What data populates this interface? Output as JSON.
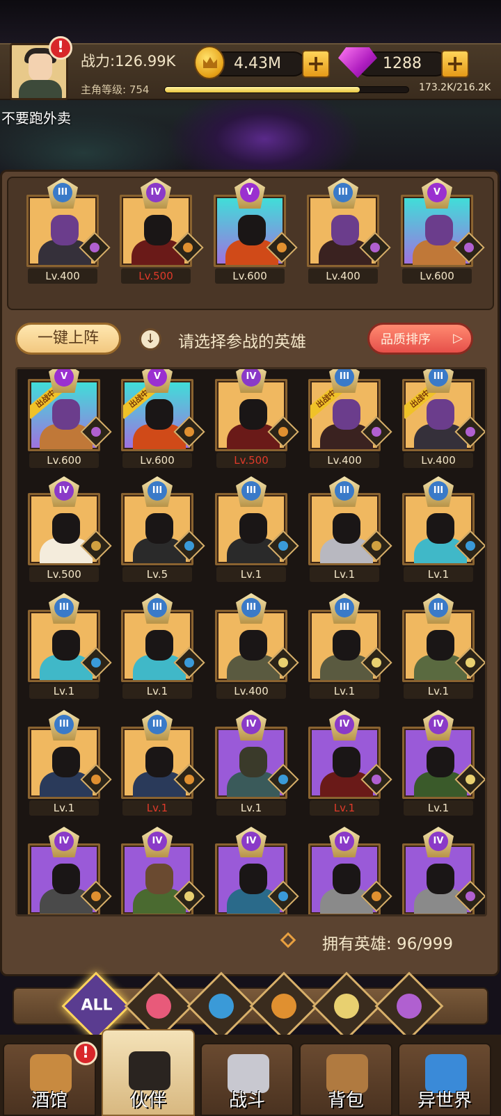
{
  "header": {
    "power": "战力:126.99K",
    "gold": "4.43M",
    "gems": "1288",
    "level_label": "主角等级: 754",
    "xp_text": "173.2K/216.2K",
    "xp_progress": 0.8,
    "username": "不要跑外卖",
    "alert": "!"
  },
  "team": [
    {
      "rank": "III",
      "level": "Lv.400",
      "max": false,
      "bg": "#f0b860",
      "hero": "#6b3d8c",
      "body": "#35303a",
      "faction": "#b060d0"
    },
    {
      "rank": "IV",
      "level": "Lv.500",
      "max": true,
      "bg": "#f0b860",
      "hero": "#1a1616",
      "body": "#6a1a18",
      "faction": "#e09030"
    },
    {
      "rank": "V",
      "level": "Lv.600",
      "max": false,
      "bg": "linear-gradient(#3ee0d8,#a070e0)",
      "hero": "#1a1616",
      "body": "#d04a18",
      "faction": "#e09030"
    },
    {
      "rank": "III",
      "level": "Lv.400",
      "max": false,
      "bg": "#f0b860",
      "hero": "#6b3d8c",
      "body": "#3a2220",
      "faction": "#b060d0"
    },
    {
      "rank": "V",
      "level": "Lv.600",
      "max": false,
      "bg": "linear-gradient(#3ee0d8,#a070e0)",
      "hero": "#6b3d8c",
      "body": "#c07838",
      "faction": "#b060d0"
    }
  ],
  "controls": {
    "one_key_label": "一键上阵",
    "info_icon": "↓",
    "select_hint": "请选择参战的英雄",
    "sort_label": "品质排序",
    "sort_arrow": "▷"
  },
  "deployed_tag": "出战中",
  "roster": [
    {
      "rank": "V",
      "level": "Lv.600",
      "max": false,
      "deployed": true,
      "bg": "linear-gradient(#3ee0d8,#a070e0)",
      "hero": "#6b3d8c",
      "body": "#c07838",
      "faction": "#b060d0"
    },
    {
      "rank": "V",
      "level": "Lv.600",
      "max": false,
      "deployed": true,
      "bg": "linear-gradient(#3ee0d8,#a070e0)",
      "hero": "#1a1616",
      "body": "#d04a18",
      "faction": "#e09030"
    },
    {
      "rank": "IV",
      "level": "Lv.500",
      "max": true,
      "deployed": false,
      "bg": "#f0b860",
      "hero": "#1a1616",
      "body": "#6a1a18",
      "faction": "#e09030"
    },
    {
      "rank": "III",
      "level": "Lv.400",
      "max": false,
      "deployed": true,
      "bg": "#f0b860",
      "hero": "#6b3d8c",
      "body": "#3a2220",
      "faction": "#b060d0"
    },
    {
      "rank": "III",
      "level": "Lv.400",
      "max": false,
      "deployed": true,
      "bg": "#f0b860",
      "hero": "#6b3d8c",
      "body": "#35303a",
      "faction": "#b060d0"
    },
    {
      "rank": "IV",
      "level": "Lv.500",
      "max": false,
      "deployed": false,
      "bg": "#f0b860",
      "hero": "#1a1616",
      "body": "#f4ecdc",
      "faction": "#d0a040"
    },
    {
      "rank": "III",
      "level": "Lv.5",
      "max": false,
      "deployed": false,
      "bg": "#f0b860",
      "hero": "#1a1616",
      "body": "#2a2a2a",
      "faction": "#3a9ad8"
    },
    {
      "rank": "III",
      "level": "Lv.1",
      "max": false,
      "deployed": false,
      "bg": "#f0b860",
      "hero": "#1a1616",
      "body": "#2a2a2a",
      "faction": "#3a9ad8"
    },
    {
      "rank": "III",
      "level": "Lv.1",
      "max": false,
      "deployed": false,
      "bg": "#f0b860",
      "hero": "#1a1616",
      "body": "#b8b8c0",
      "faction": "#d0a040"
    },
    {
      "rank": "III",
      "level": "Lv.1",
      "max": false,
      "deployed": false,
      "bg": "#f0b860",
      "hero": "#1a1616",
      "body": "#40b8c8",
      "faction": "#3a9ad8"
    },
    {
      "rank": "III",
      "level": "Lv.1",
      "max": false,
      "deployed": false,
      "bg": "#f0b860",
      "hero": "#1a1616",
      "body": "#40b8c8",
      "faction": "#3a9ad8"
    },
    {
      "rank": "III",
      "level": "Lv.1",
      "max": false,
      "deployed": false,
      "bg": "#f0b860",
      "hero": "#1a1616",
      "body": "#40b8c8",
      "faction": "#3a9ad8"
    },
    {
      "rank": "III",
      "level": "Lv.400",
      "max": false,
      "deployed": false,
      "bg": "#f0b860",
      "hero": "#1a1616",
      "body": "#5a5a40",
      "faction": "#e8d070"
    },
    {
      "rank": "III",
      "level": "Lv.1",
      "max": false,
      "deployed": false,
      "bg": "#f0b860",
      "hero": "#1a1616",
      "body": "#5a5a40",
      "faction": "#e8d070"
    },
    {
      "rank": "III",
      "level": "Lv.1",
      "max": false,
      "deployed": false,
      "bg": "#f0b860",
      "hero": "#1a1616",
      "body": "#5a6a40",
      "faction": "#e8d070"
    },
    {
      "rank": "III",
      "level": "Lv.1",
      "max": false,
      "deployed": false,
      "bg": "#f0b860",
      "hero": "#1a1616",
      "body": "#2a3a5a",
      "faction": "#e09030"
    },
    {
      "rank": "III",
      "level": "Lv.1",
      "max": true,
      "deployed": false,
      "bg": "#f0b860",
      "hero": "#1a1616",
      "body": "#2a3a5a",
      "faction": "#e09030"
    },
    {
      "rank": "IV",
      "level": "Lv.1",
      "max": false,
      "deployed": false,
      "bg": "#9a5ad8",
      "hero": "#3a3a2a",
      "body": "#3a5a5a",
      "faction": "#3a9ad8"
    },
    {
      "rank": "IV",
      "level": "Lv.1",
      "max": true,
      "deployed": false,
      "bg": "#9a5ad8",
      "hero": "#1a1616",
      "body": "#6a1a18",
      "faction": "#b060d0"
    },
    {
      "rank": "IV",
      "level": "Lv.1",
      "max": false,
      "deployed": false,
      "bg": "#9a5ad8",
      "hero": "#1a1616",
      "body": "#3a5a2a",
      "faction": "#e8d070"
    },
    {
      "rank": "IV",
      "level": "",
      "max": false,
      "deployed": false,
      "bg": "#9a5ad8",
      "hero": "#1a1616",
      "body": "#4a4a4a",
      "faction": "#e09030"
    },
    {
      "rank": "IV",
      "level": "",
      "max": false,
      "deployed": false,
      "bg": "#9a5ad8",
      "hero": "#6a4a30",
      "body": "#4a6a30",
      "faction": "#e8d070"
    },
    {
      "rank": "IV",
      "level": "",
      "max": false,
      "deployed": false,
      "bg": "#9a5ad8",
      "hero": "#1a1616",
      "body": "#2a6a8a",
      "faction": "#3a9ad8"
    },
    {
      "rank": "IV",
      "level": "",
      "max": false,
      "deployed": false,
      "bg": "#9a5ad8",
      "hero": "#1a1616",
      "body": "#8a8a8a",
      "faction": "#e09030"
    },
    {
      "rank": "IV",
      "level": "",
      "max": false,
      "deployed": false,
      "bg": "#9a5ad8",
      "hero": "#1a1616",
      "body": "#8a8a8a",
      "faction": "#b060d0"
    }
  ],
  "owned": "拥有英雄: 96/999",
  "filters": [
    {
      "name": "filter-all",
      "label": "ALL",
      "color": "#5a3c90"
    },
    {
      "name": "filter-knight-icon",
      "label": "",
      "color": "#e85a7a"
    },
    {
      "name": "filter-fish-icon",
      "label": "",
      "color": "#3a9ad8"
    },
    {
      "name": "filter-lion-icon",
      "label": "",
      "color": "#e09030"
    },
    {
      "name": "filter-elf-icon",
      "label": "",
      "color": "#e8d070"
    },
    {
      "name": "filter-demon-icon",
      "label": "",
      "color": "#b060d0"
    }
  ],
  "nav": [
    {
      "label": "酒馆",
      "active": false,
      "alert": true,
      "icon": "beer-mug-icon",
      "color": "#c88a40"
    },
    {
      "label": "伙伴",
      "active": true,
      "alert": false,
      "icon": "partner-avatar-icon",
      "color": "#2a2420"
    },
    {
      "label": "战斗",
      "active": false,
      "alert": false,
      "icon": "crossed-swords-icon",
      "color": "#c8c8d0"
    },
    {
      "label": "背包",
      "active": false,
      "alert": false,
      "icon": "backpack-icon",
      "color": "#b07a40"
    },
    {
      "label": "异世界",
      "active": false,
      "alert": false,
      "icon": "portal-icon",
      "color": "#3a8ad8"
    }
  ],
  "colors": {
    "level_normal": "#f3e6c8",
    "level_max": "#e03a2a",
    "rank_III": "#3a7ac8",
    "rank_IV": "#8a3ac8",
    "rank_V": "#9a30d0"
  }
}
